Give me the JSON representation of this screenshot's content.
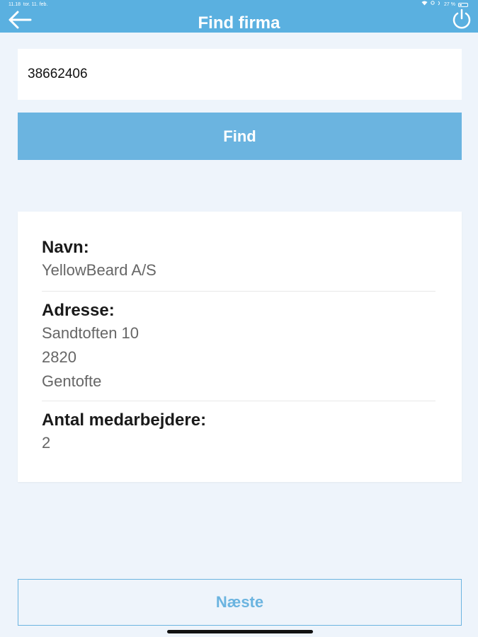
{
  "statusbar": {
    "time": "11.18",
    "date": "tor. 11. feb.",
    "battery": "27 %",
    "battery_level": 0.27
  },
  "header": {
    "title": "Find firma",
    "back_icon": "arrow-left-icon",
    "power_icon": "power-icon",
    "color": "#5ab0e0"
  },
  "search": {
    "value": "38662406"
  },
  "find_button": {
    "label": "Find"
  },
  "company": {
    "name_label": "Navn:",
    "name": "YellowBeard A/S",
    "address_label": "Adresse:",
    "address_lines": [
      "Sandtoften 10",
      "2820",
      "Gentofte"
    ],
    "employees_label": "Antal medarbejdere:",
    "employees": "2"
  },
  "next_button": {
    "label": "Næste"
  }
}
